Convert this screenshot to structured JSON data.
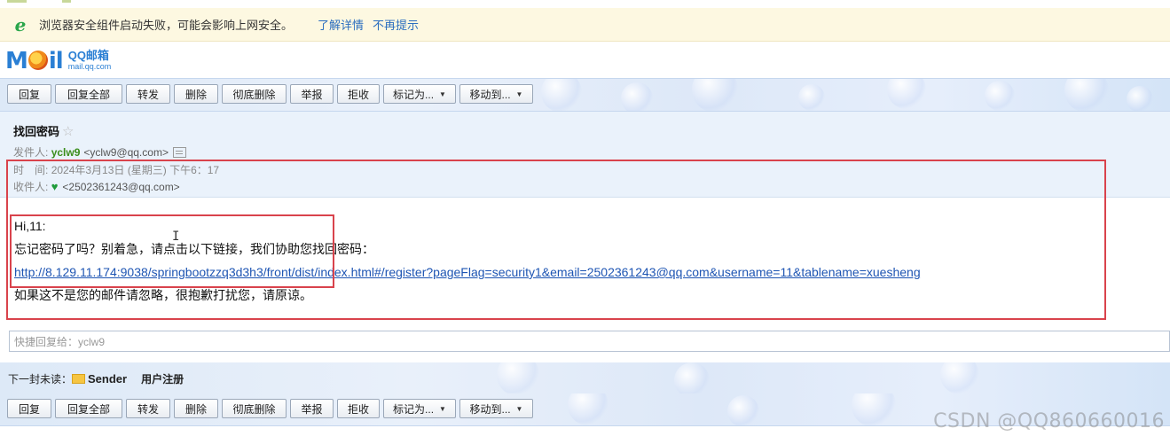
{
  "warning": {
    "icon": "ie-browser-icon",
    "message": "浏览器安全组件启动失败，可能会影响上网安全。",
    "learn_more": "了解详情",
    "dont_show": "不再提示"
  },
  "logo": {
    "main": "MOil",
    "cn": "QQ邮箱",
    "en": "mail.qq.com"
  },
  "toolbar": {
    "reply": "回复",
    "reply_all": "回复全部",
    "forward": "转发",
    "delete": "删除",
    "delete_perm": "彻底删除",
    "report": "举报",
    "reject": "拒收",
    "mark_as": "标记为...",
    "move_to": "移动到..."
  },
  "mail": {
    "subject": "找回密码",
    "from_label": "发件人:",
    "from_name": "yclw9",
    "from_addr": "<yclw9@qq.com>",
    "time_label": "时　间:",
    "time_value": "2024年3月13日 (星期三) 下午6：17",
    "to_label": "收件人:",
    "to_addr": "<2502361243@qq.com>"
  },
  "body": {
    "greeting": "Hi,11:",
    "line1": "忘记密码了吗？别着急，请点击以下链接，我们协助您找回密码：",
    "link": "http://8.129.11.174:9038/springbootzzq3d3h3/front/dist/index.html#/register?pageFlag=security1&email=2502361243@qq.com&username=11&tablename=xuesheng",
    "line2": "如果这不是您的邮件请忽略，很抱歉打扰您，请原谅。"
  },
  "quick_reply": {
    "placeholder": "快捷回复给：yclw9"
  },
  "next_unread": {
    "label": "下一封未读：",
    "sender": "Sender",
    "subject": "用户注册"
  },
  "watermark": "CSDN @QQ860660016"
}
